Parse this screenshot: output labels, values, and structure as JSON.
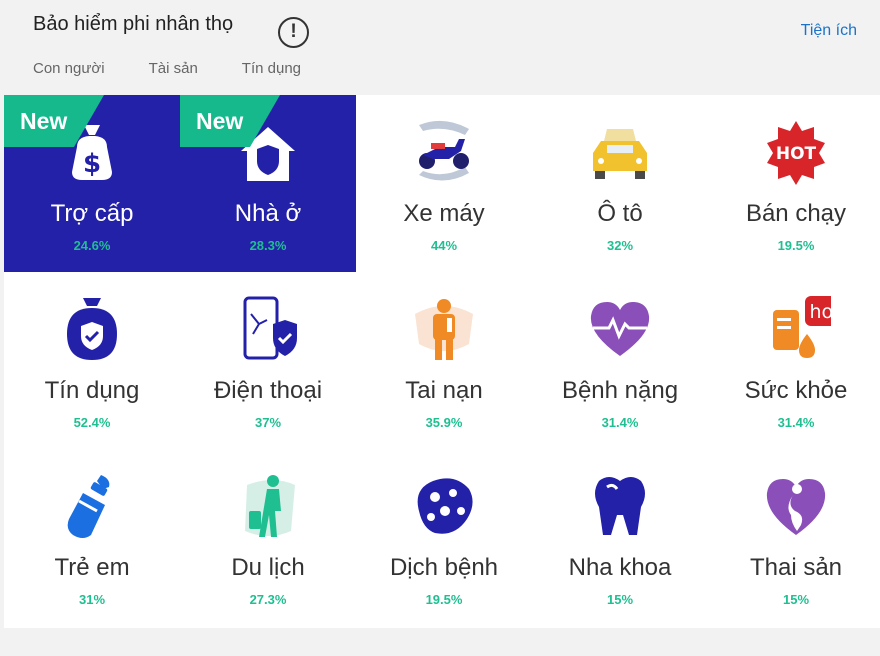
{
  "header": {
    "title": "Bảo hiểm phi nhân thọ",
    "util_link": "Tiện ích",
    "tabs": [
      "Con người",
      "Tài sản",
      "Tín dụng"
    ]
  },
  "badge_new": "New",
  "hot_badge": "HOT",
  "hot_badge_small": "hot",
  "colors": {
    "selected_bg": "#2321a8",
    "accent_green": "#1fbf91",
    "link_blue": "#1a73c8",
    "ribbon_green": "#15b98c"
  },
  "items": [
    {
      "label": "Trợ cấp",
      "pct": "24.6%",
      "icon": "money-bag-icon",
      "selected": true,
      "badge": "New"
    },
    {
      "label": "Nhà ở",
      "pct": "28.3%",
      "icon": "house-shield-icon",
      "selected": true,
      "badge": "New"
    },
    {
      "label": "Xe máy",
      "pct": "44%",
      "icon": "motorbike-icon"
    },
    {
      "label": "Ô tô",
      "pct": "32%",
      "icon": "car-icon"
    },
    {
      "label": "Bán chạy",
      "pct": "19.5%",
      "icon": "hot-badge-icon"
    },
    {
      "label": "Tín dụng",
      "pct": "52.4%",
      "icon": "credit-shield-icon"
    },
    {
      "label": "Điện thoại",
      "pct": "37%",
      "icon": "phone-shield-icon"
    },
    {
      "label": "Tai nạn",
      "pct": "35.9%",
      "icon": "accident-person-icon"
    },
    {
      "label": "Bệnh nặng",
      "pct": "31.4%",
      "icon": "heart-pulse-icon"
    },
    {
      "label": "Sức khỏe",
      "pct": "31.4%",
      "icon": "health-drip-icon"
    },
    {
      "label": "Trẻ em",
      "pct": "31%",
      "icon": "baby-bottle-icon"
    },
    {
      "label": "Du lịch",
      "pct": "27.3%",
      "icon": "traveler-icon"
    },
    {
      "label": "Dịch bệnh",
      "pct": "19.5%",
      "icon": "virus-icon"
    },
    {
      "label": "Nha khoa",
      "pct": "15%",
      "icon": "tooth-icon"
    },
    {
      "label": "Thai sản",
      "pct": "15%",
      "icon": "maternity-heart-icon"
    }
  ]
}
